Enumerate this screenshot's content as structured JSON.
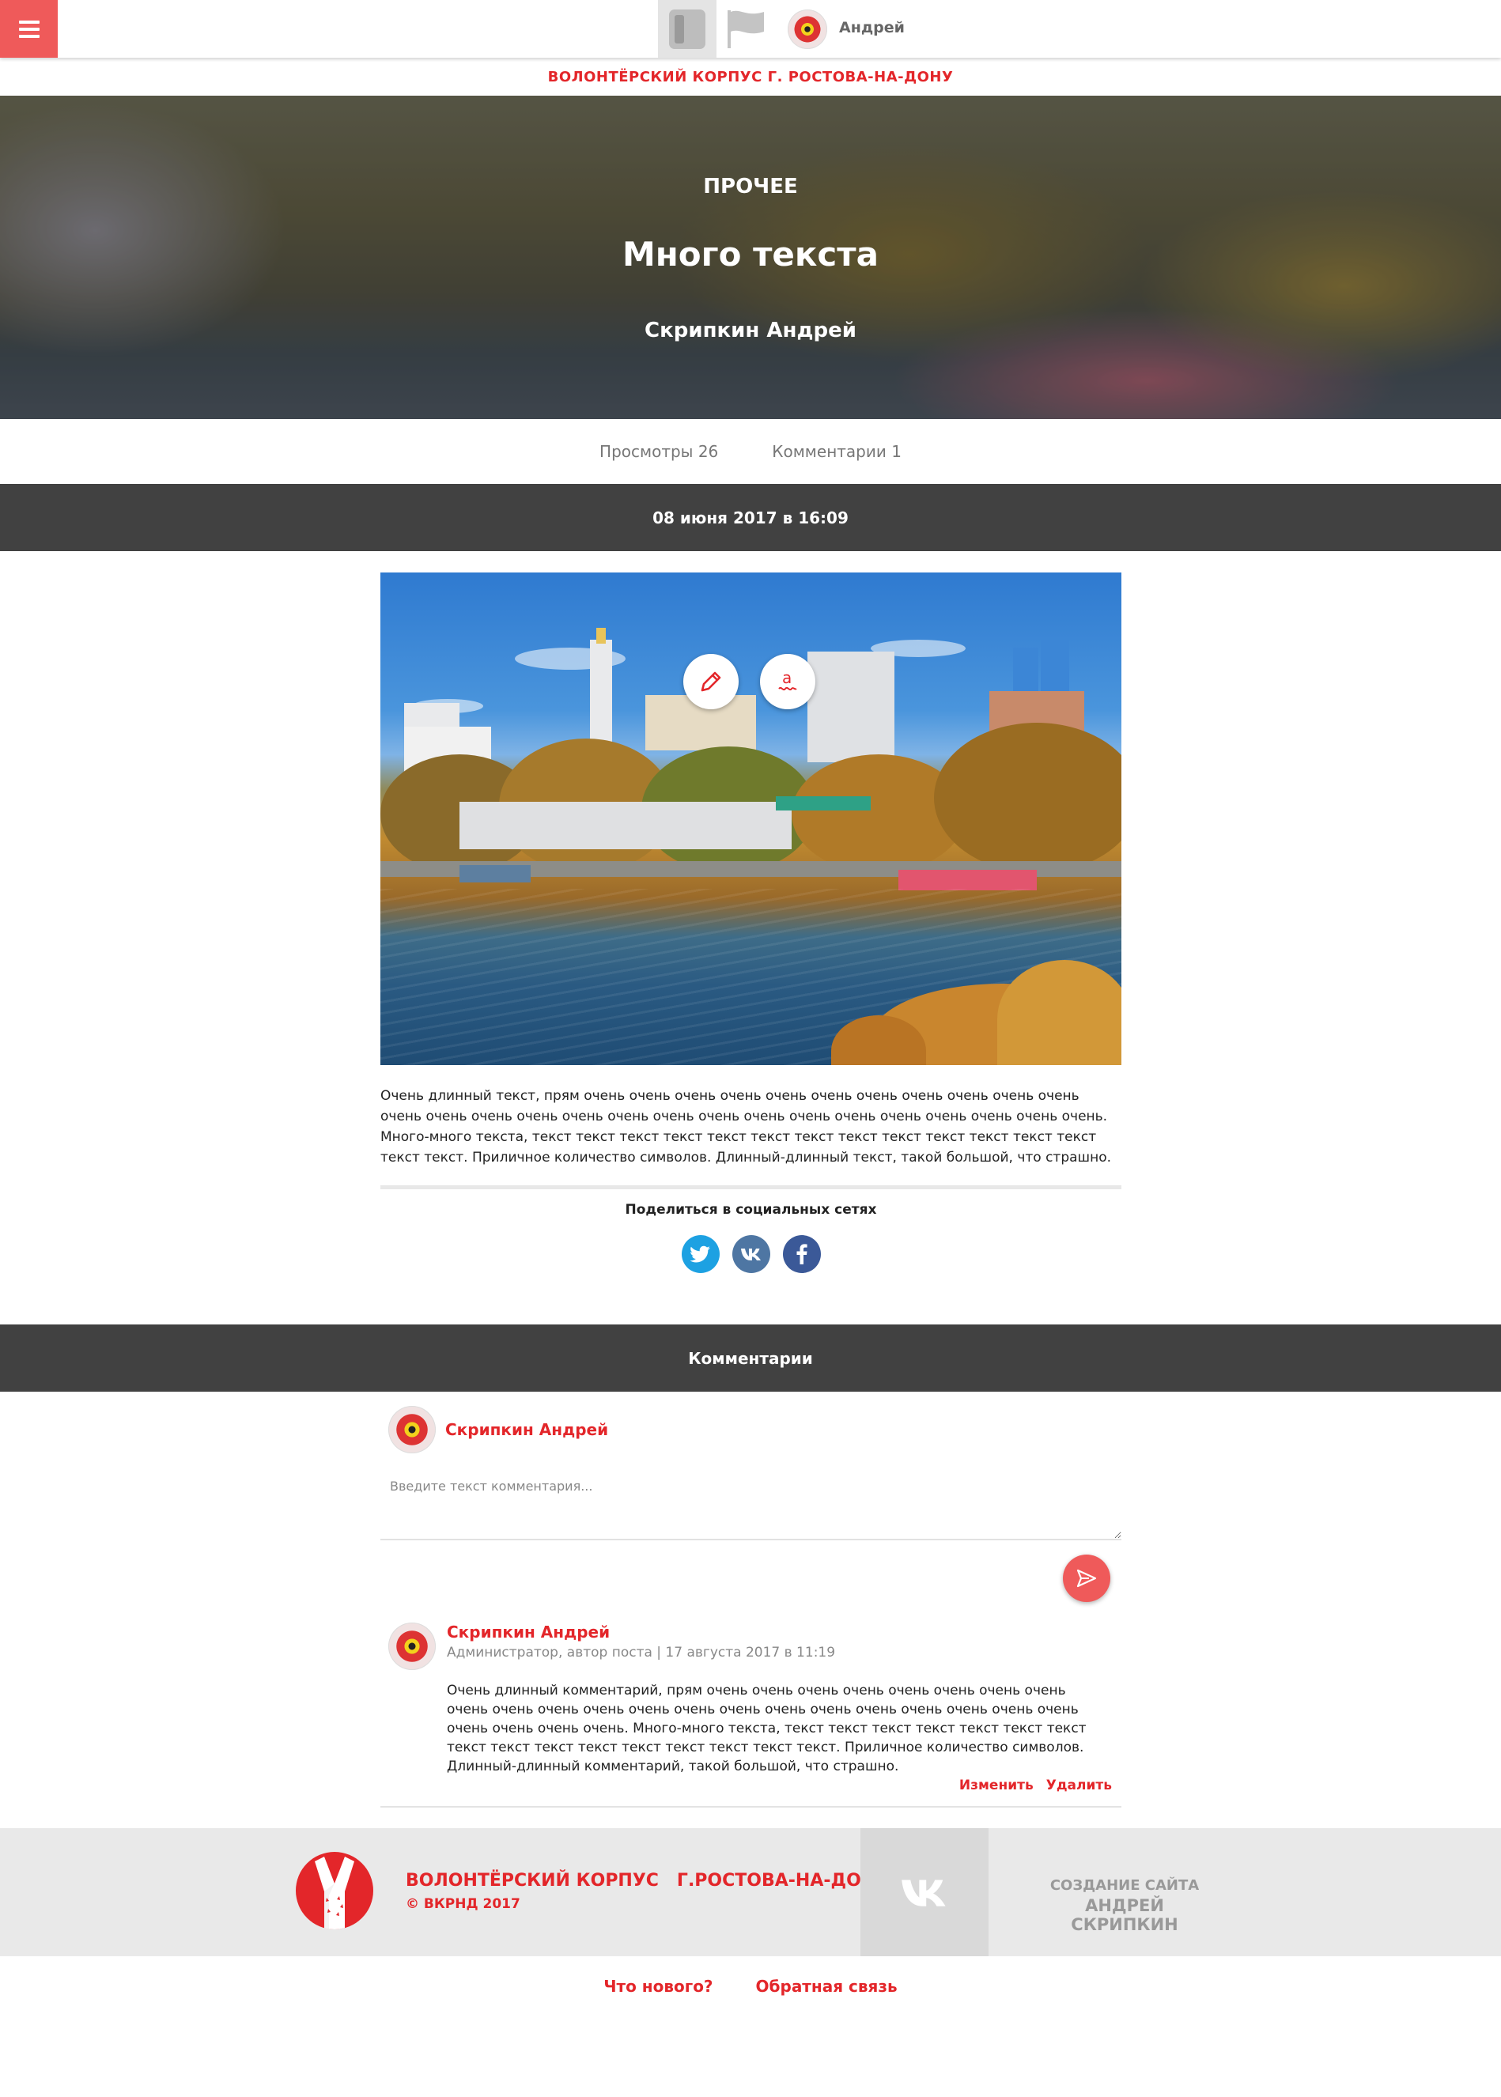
{
  "header": {
    "user_name": "Андрей",
    "org_title": "ВОЛОНТЁРСКИЙ КОРПУС Г. РОСТОВА-НА-ДОНУ"
  },
  "post": {
    "category": "ПРОЧЕЕ",
    "title": "Много текста",
    "author": "Скрипкин Андрей",
    "views": "Просмотры 26",
    "comments_count": "Комментарии 1",
    "date": "08 июня 2017 в 16:09",
    "body": "Очень длинный текст, прям очень очень очень очень очень очень очень очень очень очень очень очень очень очень очень очень очень очень очень очень очень очень очень очень очень очень очень. Много-много текста, текст текст текст текст текст текст текст текст текст текст текст текст текст текст текст. Приличное количество символов. Длинный-длинный текст, такой большой, что страшно."
  },
  "share": {
    "title": "Поделиться в социальных сетях",
    "networks": [
      "twitter-icon",
      "vk-icon",
      "facebook-icon"
    ]
  },
  "comments": {
    "section_title": "Комментарии",
    "composer": {
      "user": "Скрипкин Андрей",
      "placeholder": "Введите текст комментария..."
    },
    "items": [
      {
        "author": "Скрипкин Андрей",
        "meta": "Администратор, автор поста | 17 августа 2017 в 11:19",
        "text": "Очень длинный комментарий, прям очень очень очень очень очень очень очень очень очень очень очень очень очень очень очень очень очень очень очень очень очень очень очень очень очень очень. Много-много текста, текст текст текст текст текст текст текст текст текст текст текст текст текст текст текст текст. Приличное количество символов. Длинный-длинный комментарий, такой большой, что страшно.",
        "edit_label": "Изменить",
        "delete_label": "Удалить"
      }
    ]
  },
  "footer": {
    "org_name": "ВОЛОНТЁРСКИЙ КОРПУС   Г.РОСТОВА-НА-ДОНУ",
    "copyright": "© ВКРНД 2017",
    "created_label": "СОЗДАНИЕ САЙТА",
    "created_by": "АНДРЕЙ СКРИПКИН",
    "links": [
      "Что нового?",
      "Обратная связь"
    ]
  },
  "colors": {
    "accent": "#ef5a5a",
    "brand_red": "#e3262a",
    "dark_bar": "#414141"
  }
}
